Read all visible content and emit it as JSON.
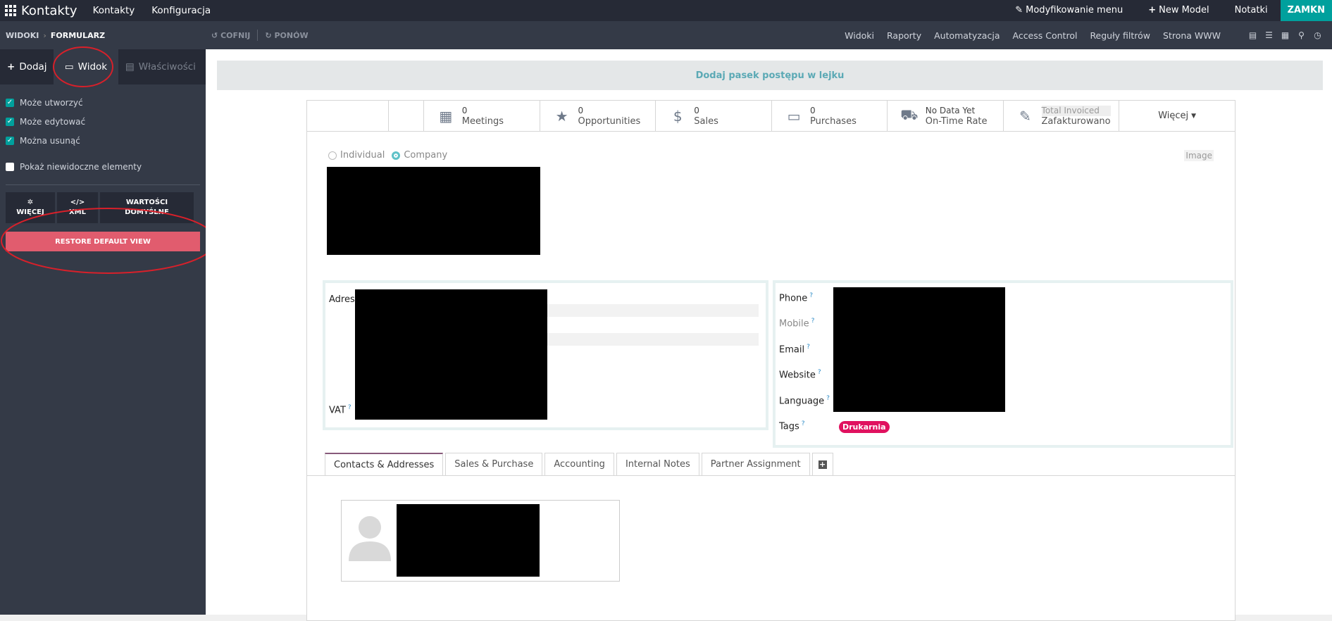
{
  "topbar": {
    "app_title": "Kontakty",
    "menu": [
      "Kontakty",
      "Konfiguracja"
    ],
    "right": {
      "edit_menu": "Modyfikowanie menu",
      "new_model": "New Model",
      "notes": "Notatki",
      "close": "ZAMKN"
    }
  },
  "studiobar": {
    "crumb_root": "WIDOKI",
    "crumb_current": "FORMULARZ",
    "undo": "COFNIJ",
    "redo": "PONÓW",
    "menu": [
      "Widoki",
      "Raporty",
      "Automatyzacja",
      "Access Control",
      "Reguły filtrów",
      "Strona WWW"
    ]
  },
  "sidebar": {
    "tabs": {
      "add": "Dodaj",
      "view": "Widok",
      "props": "Właściwości"
    },
    "options": [
      {
        "label": "Może utworzyć",
        "checked": true
      },
      {
        "label": "Może edytować",
        "checked": true
      },
      {
        "label": "Można usunąć",
        "checked": true
      },
      {
        "label": "Pokaż niewidoczne elementy",
        "checked": false
      }
    ],
    "buttons": {
      "more_line1": "WIĘCEJ",
      "xml_icon": "</>",
      "xml": "XML",
      "defaults_line1": "WARTOŚCI",
      "defaults_line2": "DOMYŚLNE"
    },
    "restore": "RESTORE DEFAULT VIEW"
  },
  "main": {
    "progress_hint": "Dodaj pasek postępu w lejku",
    "smart_buttons": [
      {
        "icon": "calendar-icon",
        "value": "0",
        "label": "Meetings"
      },
      {
        "icon": "star-icon",
        "value": "0",
        "label": "Opportunities"
      },
      {
        "icon": "dollar-icon",
        "value": "0",
        "label": "Sales"
      },
      {
        "icon": "credit-card-icon",
        "value": "0",
        "label": "Purchases"
      },
      {
        "icon": "truck-icon",
        "value": "No Data Yet",
        "label": "On-Time Rate"
      },
      {
        "icon": "edit-icon",
        "value": "Total Invoiced",
        "label": "Zafakturowano"
      }
    ],
    "more": "Więcej",
    "company_type": {
      "individual": "Individual",
      "company": "Company"
    },
    "image_label": "Image",
    "fields_left": {
      "address": "Adres",
      "vat": "VAT"
    },
    "fields_right": {
      "phone": "Phone",
      "mobile": "Mobile",
      "email": "Email",
      "website": "Website",
      "language": "Language",
      "tags": "Tags"
    },
    "tag": "Drukarnia",
    "help_mark": "?",
    "tabs": [
      "Contacts & Addresses",
      "Sales & Purchase",
      "Accounting",
      "Internal Notes",
      "Partner Assignment"
    ]
  }
}
